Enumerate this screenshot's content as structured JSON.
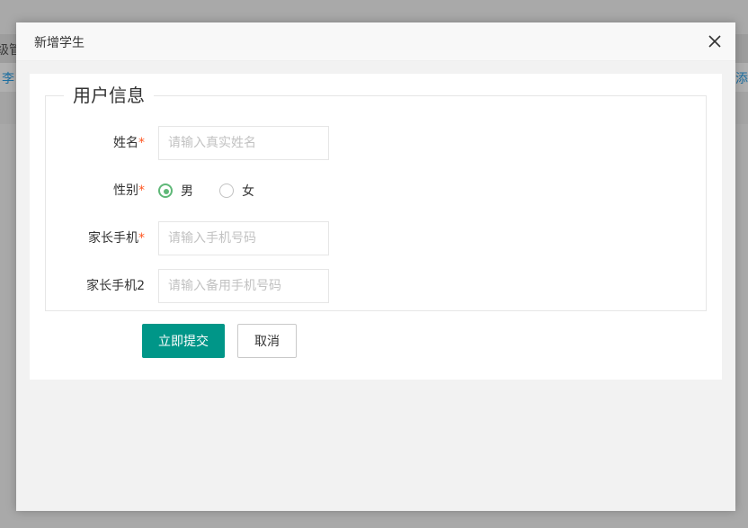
{
  "background": {
    "header_fragment": "级管",
    "row_link_left": "李",
    "row_link_right": "添加"
  },
  "modal": {
    "title": "新增学生",
    "close_icon": "close-icon"
  },
  "form": {
    "fieldset_legend": "用户信息",
    "required_mark": "*",
    "name": {
      "label": "姓名",
      "placeholder": "请输入真实姓名",
      "value": ""
    },
    "gender": {
      "label": "性别",
      "options": [
        {
          "label": "男",
          "checked": true
        },
        {
          "label": "女",
          "checked": false
        }
      ]
    },
    "parent_phone": {
      "label": "家长手机",
      "placeholder": "请输入手机号码",
      "value": ""
    },
    "parent_phone2": {
      "label": "家长手机2",
      "placeholder": "请输入备用手机号码",
      "value": ""
    },
    "submit_label": "立即提交",
    "cancel_label": "取消"
  },
  "colors": {
    "primary": "#009688",
    "radio_checked": "#5fb878",
    "required": "#ff5722"
  }
}
